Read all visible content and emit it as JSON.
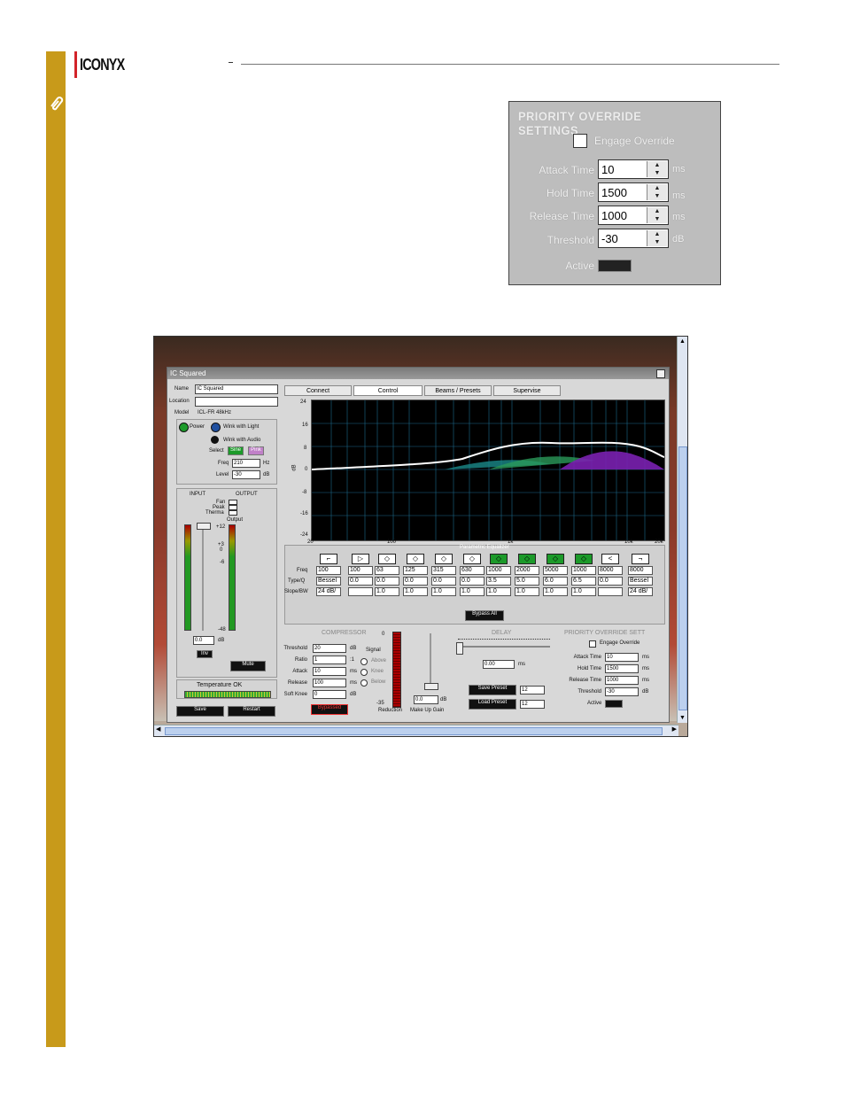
{
  "header": {
    "logo_text": "ICONYX"
  },
  "colors": {
    "gold_bar": "#c89a1a",
    "logo_red": "#d2232a",
    "eq_green": "#1c9a2a"
  },
  "priority_panel": {
    "title": "PRIORITY OVERRIDE SETTINGS",
    "engage_label": "Engage Override",
    "rows": [
      {
        "label": "Attack Time",
        "value": "10",
        "unit": "ms"
      },
      {
        "label": "Hold Time",
        "value": "1500",
        "unit": "ms"
      },
      {
        "label": "Release Time",
        "value": "1000",
        "unit": "ms"
      },
      {
        "label": "Threshold",
        "value": "-30",
        "unit": "dB"
      }
    ],
    "active_label": "Active"
  },
  "app": {
    "window_title": "IC Squared",
    "name_label": "Name",
    "name_value": "IC Squared",
    "location_label": "Location",
    "model_label": "Model",
    "model_value": "ICL-FR 48kHz",
    "power_label": "Power",
    "wink_light": "Wink with Light",
    "wink_audio": "Wink with Audio",
    "select_label": "Select",
    "sine_label": "Sine",
    "pink_label": "Pink",
    "freq_label": "Freq",
    "freq_value": "210",
    "freq_unit": "Hz",
    "level_label": "Level",
    "level_value": "-30",
    "level_unit": "dB",
    "input_label": "INPUT",
    "output_label": "OUTPUT",
    "fan_label": "Fan",
    "peak_label": "Peak",
    "thermal_label": "Therma",
    "output_small": "Output",
    "meter_top": "+12",
    "meter_bottom": "-48",
    "meter_p3": "+3",
    "meter_0": "0",
    "meter_m6": "-6",
    "gain_value": "0.0",
    "gain_unit": "dB",
    "inv_label": "Inv",
    "mute_label": "Mute",
    "temperature_label": "Temperature  OK",
    "save_label": "Save",
    "restart_label": "Restart",
    "tabs": [
      "Connect",
      "Control",
      "Beams / Presets",
      "Supervise"
    ],
    "graph": {
      "ylabel": "dB",
      "y_ticks": [
        "24",
        "16",
        "8",
        "0",
        "-8",
        "-16",
        "-24"
      ],
      "x_ticks": [
        "20",
        "100",
        "1k",
        "10k",
        "20k"
      ]
    },
    "eq": {
      "group_label": "Parametric Equalizer",
      "row_labels": [
        "Freq",
        "Type/Q",
        "Slope/BW"
      ],
      "freq": [
        "100",
        "100",
        "63",
        "125",
        "315",
        "630",
        "1000",
        "2000",
        "5000",
        "1000",
        "8000",
        "8000"
      ],
      "q": [
        "Bessel",
        "0.0",
        "0.0",
        "0.0",
        "0.0",
        "0.0",
        "3.5",
        "5.0",
        "6.0",
        "6.5",
        "0.0",
        "Bessel"
      ],
      "slope": [
        "24 dB/",
        "",
        "1.0",
        "1.0",
        "1.0",
        "1.0",
        "1.0",
        "1.0",
        "1.0",
        "1.0",
        "",
        "24 dB/"
      ],
      "bypass_all": "Bypass All"
    },
    "compressor": {
      "title": "COMPRESSOR",
      "rows": [
        {
          "label": "Threshold",
          "value": "20",
          "unit": "dB"
        },
        {
          "label": "Ratio",
          "value": "1",
          "unit": ":1"
        },
        {
          "label": "Attack",
          "value": "10",
          "unit": "ms"
        },
        {
          "label": "Release",
          "value": "100",
          "unit": "ms"
        },
        {
          "label": "Soft Knee",
          "value": "0",
          "unit": "dB"
        }
      ],
      "signal_label": "Signal",
      "above": "Above",
      "knee": "Knee",
      "below": "Below",
      "bypassed": "Bypassed",
      "reduction": "Reduction",
      "makeup_gain": "Make Up Gain",
      "makeup_value": "0.0",
      "makeup_unit": "dB",
      "scale_top": "0",
      "scale_bottom": "-35"
    },
    "delay": {
      "title": "DELAY",
      "value": "0.00",
      "unit": "ms"
    },
    "presets": {
      "save_label": "Save Preset",
      "load_label": "Load Preset",
      "save_num": "12",
      "load_num": "12"
    },
    "pov_small": {
      "title": "PRIORITY OVERRIDE SETT",
      "engage_label": "Engage Override",
      "rows": [
        {
          "label": "Attack Time",
          "value": "10",
          "unit": "ms"
        },
        {
          "label": "Hold Time",
          "value": "1500",
          "unit": "ms"
        },
        {
          "label": "Release Time",
          "value": "1000",
          "unit": "ms"
        },
        {
          "label": "Threshold",
          "value": "-30",
          "unit": "dB"
        }
      ],
      "active_label": "Active"
    }
  }
}
